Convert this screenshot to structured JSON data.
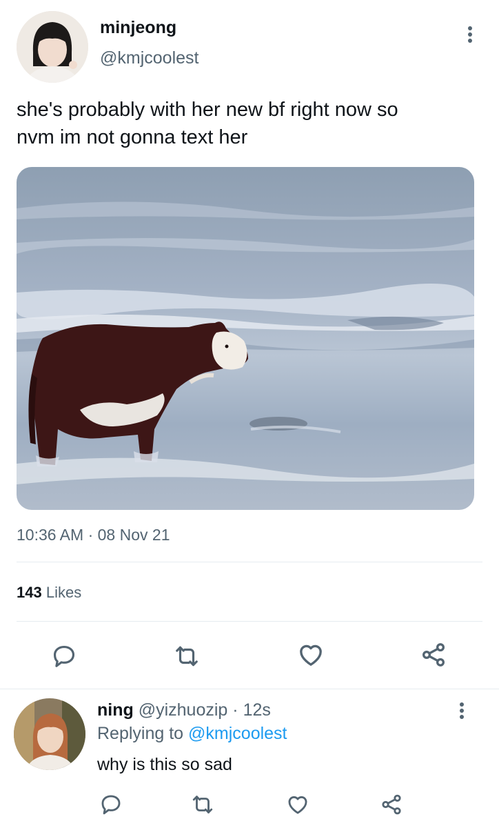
{
  "tweet": {
    "display_name": "minjeong",
    "handle": "@kmjcoolest",
    "text_line1": "she's probably with her new bf right now so",
    "text_line2": "nvm im not gonna text her",
    "time": "10:36 AM",
    "separator": "·",
    "date": "08 Nov 21",
    "likes_count": "143",
    "likes_label": "Likes"
  },
  "reply": {
    "display_name": "ning",
    "handle": "@yizhuozip",
    "separator": "·",
    "age": "12s",
    "replying_prefix": "Replying to",
    "replying_handle": "@kmjcoolest",
    "text": "why is this so sad"
  },
  "icons": {
    "reply": "reply-icon",
    "retweet": "retweet-icon",
    "like": "heart-icon",
    "share": "share-icon",
    "more": "more-vertical-icon"
  },
  "colors": {
    "link": "#1d9bf0",
    "secondary_text": "#536471",
    "primary_text": "#0f1419"
  }
}
